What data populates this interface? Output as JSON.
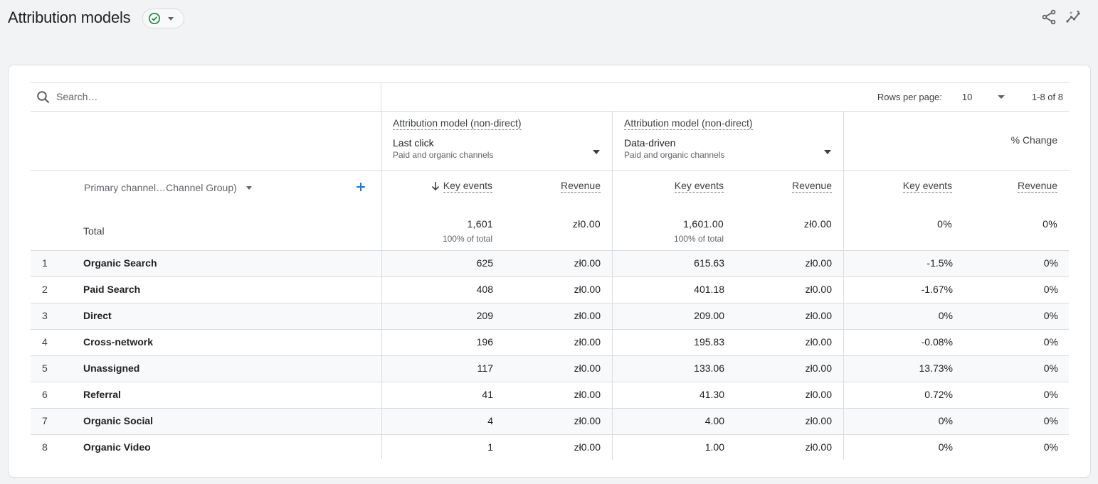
{
  "header": {
    "title": "Attribution models",
    "share_icon": "share-icon",
    "insights_icon": "insights-icon"
  },
  "toolbar": {
    "search_placeholder": "Search…",
    "rows_per_page_label": "Rows per page:",
    "rows_per_page_value": "10",
    "range": "1-8 of 8"
  },
  "models": [
    {
      "label": "Attribution model (non-direct)",
      "name": "Last click",
      "sub": "Paid and organic channels"
    },
    {
      "label": "Attribution model (non-direct)",
      "name": "Data-driven",
      "sub": "Paid and organic channels"
    }
  ],
  "change_label": "% Change",
  "dimension_label": "Primary channel…Channel Group)",
  "metric_headers": [
    "Key events",
    "Revenue",
    "Key events",
    "Revenue",
    "Key events",
    "Revenue"
  ],
  "total": {
    "label": "Total",
    "values": [
      "1,601",
      "zł0.00",
      "1,601.00",
      "zł0.00",
      "0%",
      "0%"
    ],
    "subs": [
      "100% of total",
      "100% of total"
    ]
  },
  "rows": [
    {
      "idx": "1",
      "name": "Organic Search",
      "values": [
        "625",
        "zł0.00",
        "615.63",
        "zł0.00",
        "-1.5%",
        "0%"
      ]
    },
    {
      "idx": "2",
      "name": "Paid Search",
      "values": [
        "408",
        "zł0.00",
        "401.18",
        "zł0.00",
        "-1.67%",
        "0%"
      ]
    },
    {
      "idx": "3",
      "name": "Direct",
      "values": [
        "209",
        "zł0.00",
        "209.00",
        "zł0.00",
        "0%",
        "0%"
      ]
    },
    {
      "idx": "4",
      "name": "Cross-network",
      "values": [
        "196",
        "zł0.00",
        "195.83",
        "zł0.00",
        "-0.08%",
        "0%"
      ]
    },
    {
      "idx": "5",
      "name": "Unassigned",
      "values": [
        "117",
        "zł0.00",
        "133.06",
        "zł0.00",
        "13.73%",
        "0%"
      ]
    },
    {
      "idx": "6",
      "name": "Referral",
      "values": [
        "41",
        "zł0.00",
        "41.30",
        "zł0.00",
        "0.72%",
        "0%"
      ]
    },
    {
      "idx": "7",
      "name": "Organic Social",
      "values": [
        "4",
        "zł0.00",
        "4.00",
        "zł0.00",
        "0%",
        "0%"
      ]
    },
    {
      "idx": "8",
      "name": "Organic Video",
      "values": [
        "1",
        "zł0.00",
        "1.00",
        "zł0.00",
        "0%",
        "0%"
      ]
    }
  ],
  "colors": {
    "check": "#188038",
    "plus": "#1a73e8"
  }
}
